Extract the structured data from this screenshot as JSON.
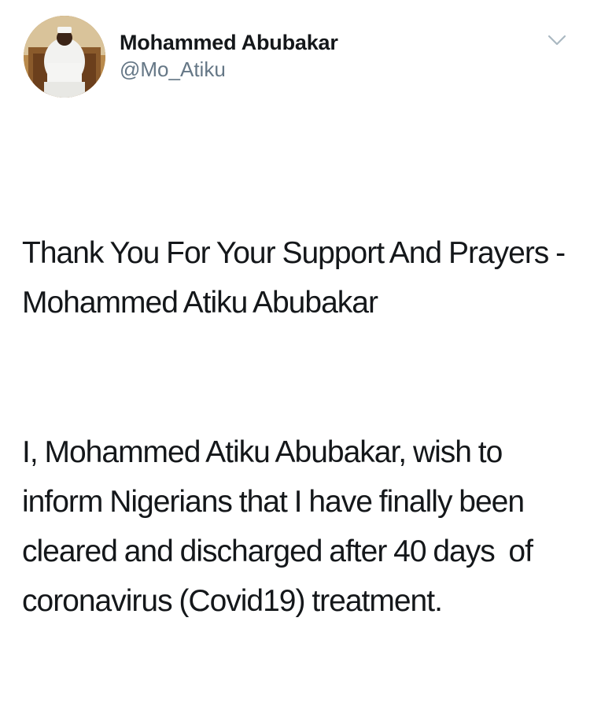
{
  "tweet": {
    "author": {
      "display_name": "Mohammed Abubakar",
      "handle": "@Mo_Atiku",
      "avatar": "avatar-photo"
    },
    "menu_icon": "chevron-down-icon",
    "text": {
      "headline": "Thank You For Your Support And Prayers - Mohammed Atiku Abubakar",
      "body": "I, Mohammed Atiku Abubakar, wish to inform Nigerians that I have finally been cleared and discharged after 40 days  of coronavirus (Covid19) treatment."
    }
  },
  "colors": {
    "text": "#14171a",
    "secondary_text": "#657786",
    "chevron": "#aab8c2",
    "background": "#ffffff"
  }
}
